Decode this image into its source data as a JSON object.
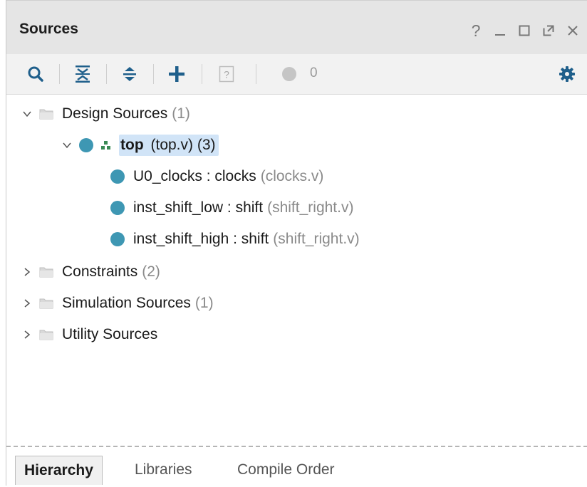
{
  "panel": {
    "title": "Sources",
    "window_controls": [
      "help-icon",
      "minimize-icon",
      "maximize-icon",
      "float-icon",
      "close-icon"
    ]
  },
  "toolbar": {
    "buttons": [
      "search-icon",
      "collapse-all-icon",
      "expand-all-icon",
      "add-icon",
      "unknown-status-icon",
      "status-dot-icon"
    ],
    "status_count": "0",
    "settings": "gear-icon"
  },
  "tree": {
    "design_sources": {
      "label": "Design Sources",
      "count": "(1)"
    },
    "top": {
      "name": "top",
      "file": "(top.v) (3)"
    },
    "children": [
      {
        "instance": "U0_clocks : clocks",
        "file": "(clocks.v)"
      },
      {
        "instance": "inst_shift_low : shift",
        "file": "(shift_right.v)"
      },
      {
        "instance": "inst_shift_high : shift",
        "file": "(shift_right.v)"
      }
    ],
    "constraints": {
      "label": "Constraints",
      "count": "(2)"
    },
    "simulation_sources": {
      "label": "Simulation Sources",
      "count": "(1)"
    },
    "utility_sources": {
      "label": "Utility Sources"
    }
  },
  "tabs": [
    "Hierarchy",
    "Libraries",
    "Compile Order"
  ],
  "colors": {
    "accent_dot": "#3e97b3",
    "selection": "#d1e4f7",
    "titlebar": "#e5e5e5"
  }
}
